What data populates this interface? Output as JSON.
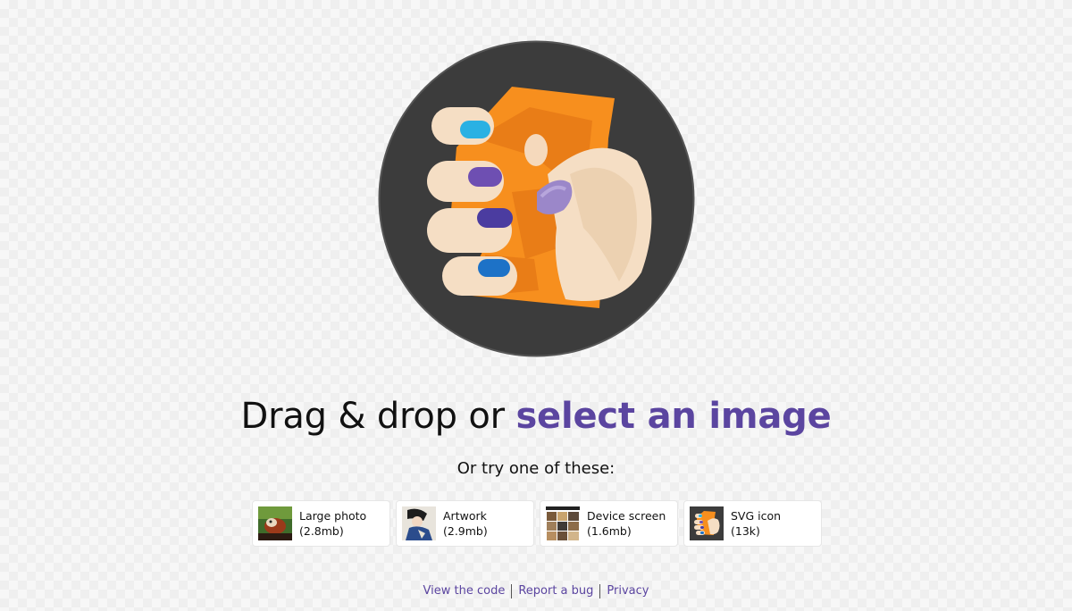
{
  "drop_area": {
    "headline_prefix": "Drag & drop or",
    "select_link": "select an image",
    "subheading": "Or try one of these:"
  },
  "demos": [
    {
      "title": "Large photo",
      "size": "(2.8mb)",
      "icon": "red-panda-photo"
    },
    {
      "title": "Artwork",
      "size": "(2.9mb)",
      "icon": "artwork-painting"
    },
    {
      "title": "Device screen",
      "size": "(1.6mb)",
      "icon": "device-screenshot"
    },
    {
      "title": "SVG icon",
      "size": "(13k)",
      "icon": "squoosh-logo"
    }
  ],
  "footer": {
    "links": [
      "View the code",
      "Report a bug",
      "Privacy"
    ]
  },
  "colors": {
    "accent": "#5b45a0",
    "logo_background": "#3c3c3c",
    "logo_orange": "#f78f1e"
  }
}
